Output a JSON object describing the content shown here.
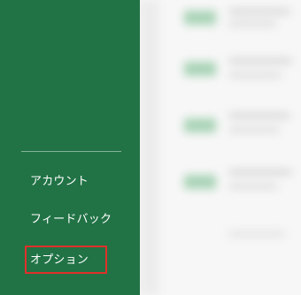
{
  "sidebar": {
    "items": [
      {
        "label": "アカウント"
      },
      {
        "label": "フィードバック"
      },
      {
        "label": "オプション"
      }
    ],
    "background_color": "#217346",
    "highlight_color": "#e0302a"
  }
}
